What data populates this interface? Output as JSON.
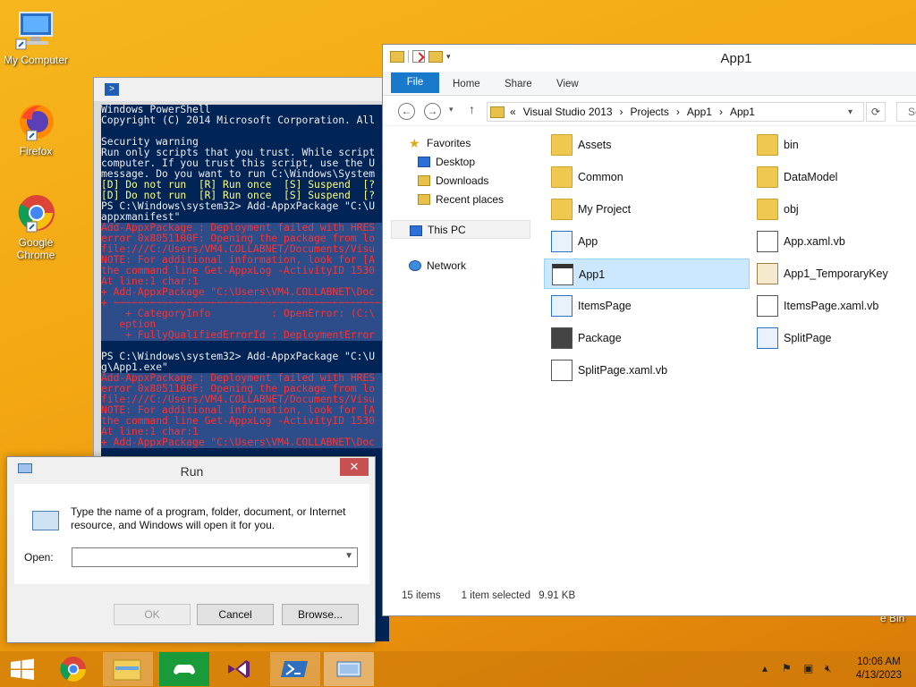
{
  "desktop": {
    "icons": [
      {
        "label": "My Computer"
      },
      {
        "label": "Firefox"
      },
      {
        "label": "Google Chrome"
      }
    ],
    "recycle_bin_label": "e Bin"
  },
  "powershell": {
    "lines": [
      {
        "text": "Windows PowerShell",
        "style": ""
      },
      {
        "text": "Copyright (C) 2014 Microsoft Corporation. All rights",
        "style": ""
      },
      {
        "text": "",
        "style": ""
      },
      {
        "text": "Security warning",
        "style": ""
      },
      {
        "text": "Run only scripts that you trust. While script",
        "style": ""
      },
      {
        "text": "computer. If you trust this script, use the U",
        "style": ""
      },
      {
        "text": "message. Do you want to run C:\\Windows\\System",
        "style": ""
      },
      {
        "text": "[D] Do not run  [R] Run once  [S] Suspend  [?",
        "style": "y"
      },
      {
        "text": "[D] Do not run  [R] Run once  [S] Suspend  [?",
        "style": "y"
      },
      {
        "text": "PS C:\\Windows\\system32> Add-AppxPackage \"C:\\U",
        "style": ""
      },
      {
        "text": "appxmanifest\"",
        "style": ""
      },
      {
        "text": "Add-AppxPackage : Deployment failed with HRES",
        "style": "r hl"
      },
      {
        "text": "error 0x8051100F: Opening the package from lo",
        "style": "r hl"
      },
      {
        "text": "file:///C:/Users/VM4.COLLABNET/Documents/Visu",
        "style": "r hl"
      },
      {
        "text": "NOTE: For additional information, look for [A",
        "style": "r hl"
      },
      {
        "text": "the command line Get-AppxLog -ActivityID 1530",
        "style": "r hl"
      },
      {
        "text": "At line:1 char:1",
        "style": "r hl"
      },
      {
        "text": "+ Add-AppxPackage \"C:\\Users\\VM4.COLLABNET\\Doc",
        "style": "r hl"
      },
      {
        "text": "+ ~~~~~~~~~~~~~~~~~~~~~~~~~~~~~~~~~~~~~~~~~~~~",
        "style": "r hl"
      },
      {
        "text": "    + CategoryInfo          : OpenError: (C:\\",
        "style": "r hl"
      },
      {
        "text": "   eption",
        "style": "r hl"
      },
      {
        "text": "    + FullyQualifiedErrorId : DeploymentError",
        "style": "r hl"
      },
      {
        "text": "",
        "style": ""
      },
      {
        "text": "PS C:\\Windows\\system32> Add-AppxPackage \"C:\\U",
        "style": ""
      },
      {
        "text": "g\\App1.exe\"",
        "style": ""
      },
      {
        "text": "Add-AppxPackage : Deployment failed with HRES",
        "style": "r hl"
      },
      {
        "text": "error 0x8051100F: Opening the package from lo",
        "style": "r hl"
      },
      {
        "text": "file:///C:/Users/VM4.COLLABNET/Documents/Visu",
        "style": "r hl"
      },
      {
        "text": "NOTE: For additional information, look for [A",
        "style": "r hl"
      },
      {
        "text": "the command line Get-AppxLog -ActivityID 1530",
        "style": "r hl"
      },
      {
        "text": "At line:1 char:1",
        "style": "r hl"
      },
      {
        "text": "+ Add-AppxPackage \"C:\\Users\\VM4.COLLABNET\\Doc",
        "style": "r hl"
      }
    ]
  },
  "explorer": {
    "title": "App1",
    "ribbon_tabs": [
      "File",
      "Home",
      "Share",
      "View"
    ],
    "address": [
      "Visual Studio 2013",
      "Projects",
      "App1",
      "App1"
    ],
    "address_prefix": "«",
    "search_placeholder": "Se",
    "nav": [
      {
        "label": "Favorites",
        "icon": "star-icon"
      },
      {
        "label": "Desktop",
        "icon": "desktop-icon"
      },
      {
        "label": "Downloads",
        "icon": "downloads-icon"
      },
      {
        "label": "Recent places",
        "icon": "recent-places-icon"
      },
      {
        "label": "This PC",
        "icon": "computer-icon"
      },
      {
        "label": "Network",
        "icon": "network-icon"
      }
    ],
    "files": [
      {
        "name": "Assets",
        "type": "folder"
      },
      {
        "name": "bin",
        "type": "folder"
      },
      {
        "name": "Common",
        "type": "folder"
      },
      {
        "name": "DataModel",
        "type": "folder"
      },
      {
        "name": "My Project",
        "type": "folder"
      },
      {
        "name": "obj",
        "type": "folder"
      },
      {
        "name": "App",
        "type": "xaml"
      },
      {
        "name": "App.xaml.vb",
        "type": "vb"
      },
      {
        "name": "App1",
        "type": "project",
        "selected": true
      },
      {
        "name": "App1_TemporaryKey",
        "type": "key"
      },
      {
        "name": "ItemsPage",
        "type": "xaml"
      },
      {
        "name": "ItemsPage.xaml.vb",
        "type": "vb"
      },
      {
        "name": "Package",
        "type": "manifest"
      },
      {
        "name": "SplitPage",
        "type": "xaml"
      },
      {
        "name": "SplitPage.xaml.vb",
        "type": "vb"
      }
    ],
    "status": {
      "count": "15 items",
      "selected": "1 item selected",
      "size": "9.91 KB"
    }
  },
  "run": {
    "title": "Run",
    "message": "Type the name of a program, folder, document, or Internet resource, and Windows will open it for you.",
    "open_label": "Open:",
    "open_value": "",
    "ok": "OK",
    "cancel": "Cancel",
    "browse": "Browse..."
  },
  "taskbar": {
    "time": "10:06 AM",
    "date": "4/13/2023"
  }
}
